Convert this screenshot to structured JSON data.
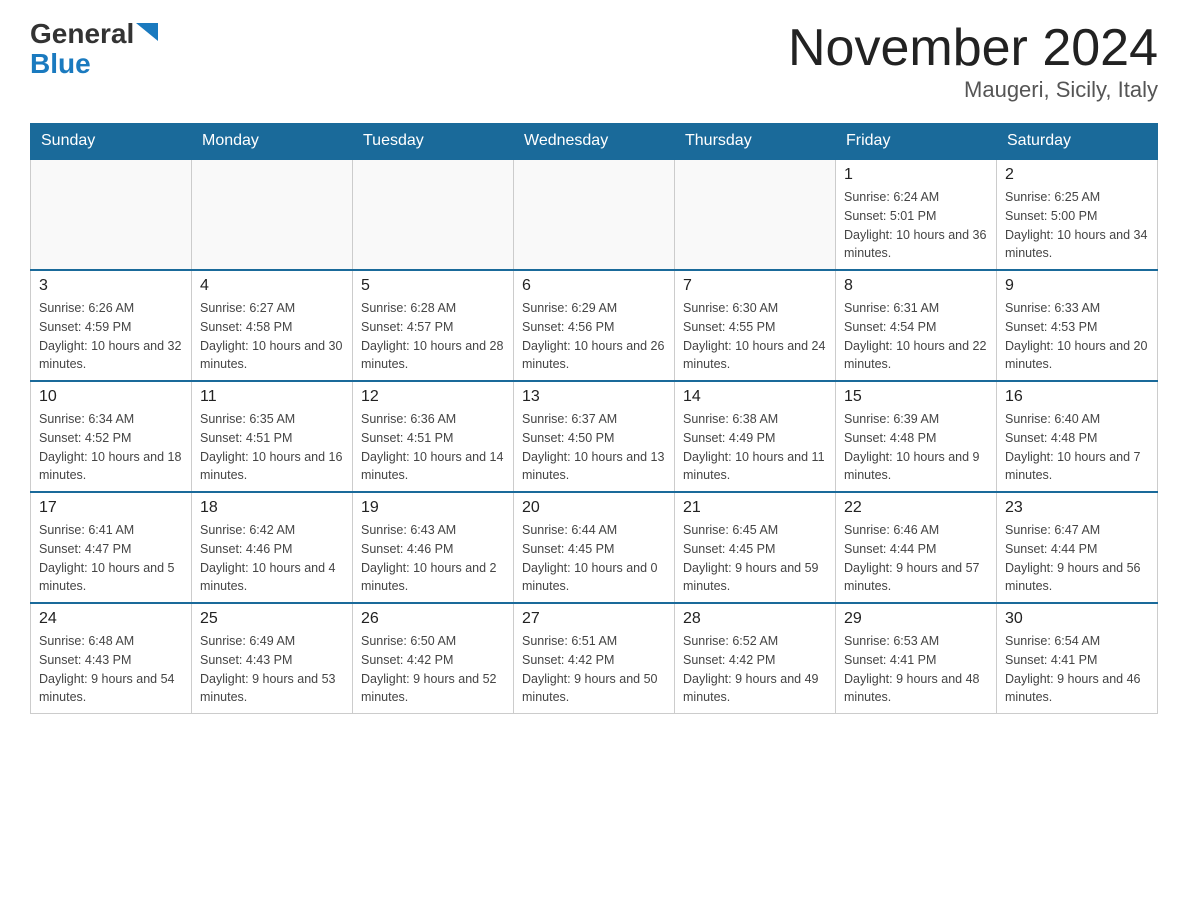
{
  "header": {
    "logo_general": "General",
    "logo_blue": "Blue",
    "title": "November 2024",
    "subtitle": "Maugeri, Sicily, Italy"
  },
  "days_of_week": [
    "Sunday",
    "Monday",
    "Tuesday",
    "Wednesday",
    "Thursday",
    "Friday",
    "Saturday"
  ],
  "weeks": [
    [
      {
        "day": "",
        "info": ""
      },
      {
        "day": "",
        "info": ""
      },
      {
        "day": "",
        "info": ""
      },
      {
        "day": "",
        "info": ""
      },
      {
        "day": "",
        "info": ""
      },
      {
        "day": "1",
        "info": "Sunrise: 6:24 AM\nSunset: 5:01 PM\nDaylight: 10 hours and 36 minutes."
      },
      {
        "day": "2",
        "info": "Sunrise: 6:25 AM\nSunset: 5:00 PM\nDaylight: 10 hours and 34 minutes."
      }
    ],
    [
      {
        "day": "3",
        "info": "Sunrise: 6:26 AM\nSunset: 4:59 PM\nDaylight: 10 hours and 32 minutes."
      },
      {
        "day": "4",
        "info": "Sunrise: 6:27 AM\nSunset: 4:58 PM\nDaylight: 10 hours and 30 minutes."
      },
      {
        "day": "5",
        "info": "Sunrise: 6:28 AM\nSunset: 4:57 PM\nDaylight: 10 hours and 28 minutes."
      },
      {
        "day": "6",
        "info": "Sunrise: 6:29 AM\nSunset: 4:56 PM\nDaylight: 10 hours and 26 minutes."
      },
      {
        "day": "7",
        "info": "Sunrise: 6:30 AM\nSunset: 4:55 PM\nDaylight: 10 hours and 24 minutes."
      },
      {
        "day": "8",
        "info": "Sunrise: 6:31 AM\nSunset: 4:54 PM\nDaylight: 10 hours and 22 minutes."
      },
      {
        "day": "9",
        "info": "Sunrise: 6:33 AM\nSunset: 4:53 PM\nDaylight: 10 hours and 20 minutes."
      }
    ],
    [
      {
        "day": "10",
        "info": "Sunrise: 6:34 AM\nSunset: 4:52 PM\nDaylight: 10 hours and 18 minutes."
      },
      {
        "day": "11",
        "info": "Sunrise: 6:35 AM\nSunset: 4:51 PM\nDaylight: 10 hours and 16 minutes."
      },
      {
        "day": "12",
        "info": "Sunrise: 6:36 AM\nSunset: 4:51 PM\nDaylight: 10 hours and 14 minutes."
      },
      {
        "day": "13",
        "info": "Sunrise: 6:37 AM\nSunset: 4:50 PM\nDaylight: 10 hours and 13 minutes."
      },
      {
        "day": "14",
        "info": "Sunrise: 6:38 AM\nSunset: 4:49 PM\nDaylight: 10 hours and 11 minutes."
      },
      {
        "day": "15",
        "info": "Sunrise: 6:39 AM\nSunset: 4:48 PM\nDaylight: 10 hours and 9 minutes."
      },
      {
        "day": "16",
        "info": "Sunrise: 6:40 AM\nSunset: 4:48 PM\nDaylight: 10 hours and 7 minutes."
      }
    ],
    [
      {
        "day": "17",
        "info": "Sunrise: 6:41 AM\nSunset: 4:47 PM\nDaylight: 10 hours and 5 minutes."
      },
      {
        "day": "18",
        "info": "Sunrise: 6:42 AM\nSunset: 4:46 PM\nDaylight: 10 hours and 4 minutes."
      },
      {
        "day": "19",
        "info": "Sunrise: 6:43 AM\nSunset: 4:46 PM\nDaylight: 10 hours and 2 minutes."
      },
      {
        "day": "20",
        "info": "Sunrise: 6:44 AM\nSunset: 4:45 PM\nDaylight: 10 hours and 0 minutes."
      },
      {
        "day": "21",
        "info": "Sunrise: 6:45 AM\nSunset: 4:45 PM\nDaylight: 9 hours and 59 minutes."
      },
      {
        "day": "22",
        "info": "Sunrise: 6:46 AM\nSunset: 4:44 PM\nDaylight: 9 hours and 57 minutes."
      },
      {
        "day": "23",
        "info": "Sunrise: 6:47 AM\nSunset: 4:44 PM\nDaylight: 9 hours and 56 minutes."
      }
    ],
    [
      {
        "day": "24",
        "info": "Sunrise: 6:48 AM\nSunset: 4:43 PM\nDaylight: 9 hours and 54 minutes."
      },
      {
        "day": "25",
        "info": "Sunrise: 6:49 AM\nSunset: 4:43 PM\nDaylight: 9 hours and 53 minutes."
      },
      {
        "day": "26",
        "info": "Sunrise: 6:50 AM\nSunset: 4:42 PM\nDaylight: 9 hours and 52 minutes."
      },
      {
        "day": "27",
        "info": "Sunrise: 6:51 AM\nSunset: 4:42 PM\nDaylight: 9 hours and 50 minutes."
      },
      {
        "day": "28",
        "info": "Sunrise: 6:52 AM\nSunset: 4:42 PM\nDaylight: 9 hours and 49 minutes."
      },
      {
        "day": "29",
        "info": "Sunrise: 6:53 AM\nSunset: 4:41 PM\nDaylight: 9 hours and 48 minutes."
      },
      {
        "day": "30",
        "info": "Sunrise: 6:54 AM\nSunset: 4:41 PM\nDaylight: 9 hours and 46 minutes."
      }
    ]
  ]
}
